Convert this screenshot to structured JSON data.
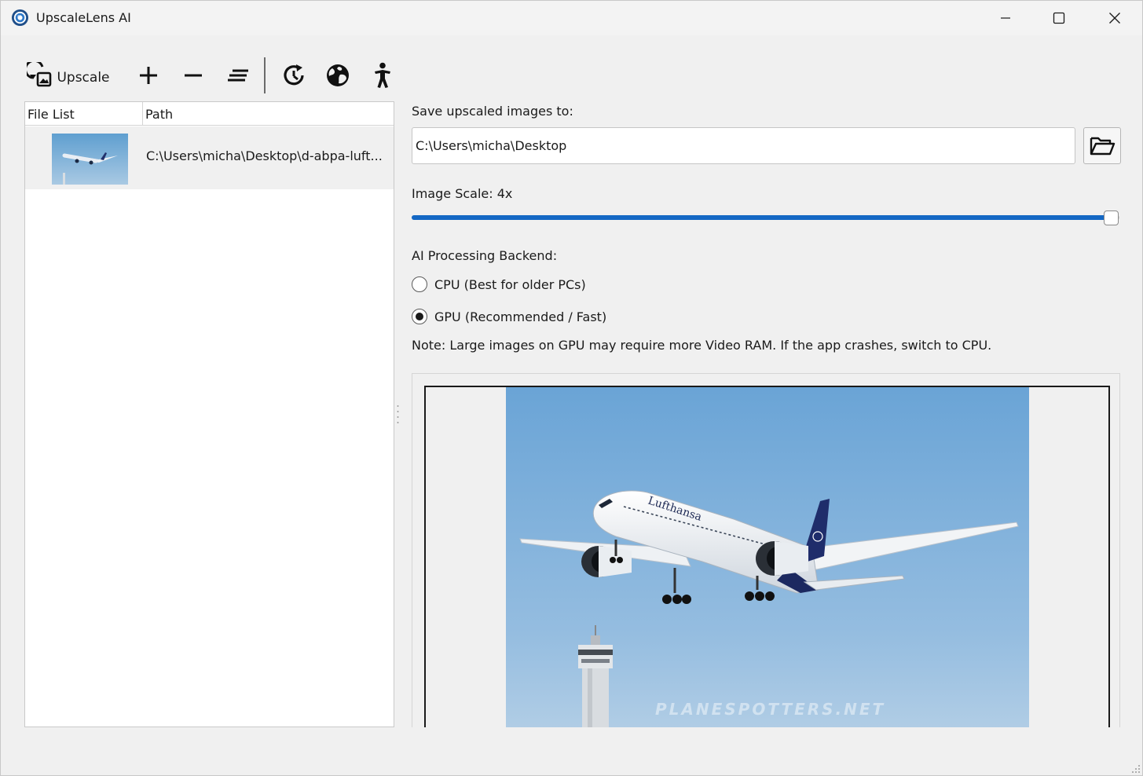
{
  "window": {
    "title": "UpscaleLens AI"
  },
  "toolbar": {
    "upscale_label": "Upscale"
  },
  "file_list": {
    "columns": [
      "File List",
      "Path"
    ],
    "rows": [
      {
        "path": "C:\\Users\\micha\\Desktop\\d-abpa-luft..."
      }
    ]
  },
  "settings": {
    "save_label": "Save upscaled images to:",
    "save_path": "C:\\Users\\micha\\Desktop",
    "scale_label": "Image Scale: 4x",
    "scale_fraction": 1.0,
    "backend_label": "AI Processing Backend:",
    "backend_options": [
      {
        "label": "CPU (Best for older PCs)",
        "selected": false
      },
      {
        "label": "GPU (Recommended / Fast)",
        "selected": true
      }
    ],
    "note": "Note: Large images on GPU may require more Video RAM. If the app crashes, switch to CPU."
  },
  "preview": {
    "watermark": "PLANESPOTTERS.NET"
  },
  "colors": {
    "accent": "#1468c4",
    "window_bg": "#f0f0f0"
  },
  "icons": {
    "app": "app-lens-icon",
    "upscale": "upscale-image-icon",
    "add": "plus-icon",
    "remove": "minus-icon",
    "clear": "clear-list-icon",
    "history": "history-icon",
    "language": "globe-icon",
    "accessibility": "accessibility-icon",
    "browse": "folder-open-icon"
  }
}
